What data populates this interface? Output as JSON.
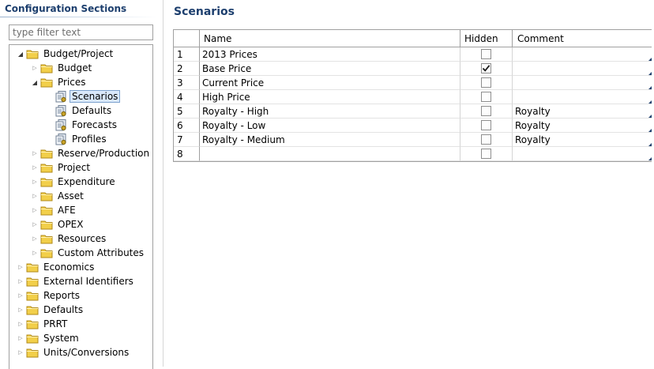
{
  "sidebar": {
    "title": "Configuration Sections",
    "filter_placeholder": "type filter text",
    "items": [
      {
        "label": "Budget/Project",
        "depth": 1,
        "state": "open",
        "icon": "folder-icon"
      },
      {
        "label": "Budget",
        "depth": 2,
        "state": "closed",
        "icon": "folder-icon"
      },
      {
        "label": "Prices",
        "depth": 2,
        "state": "open",
        "icon": "folder-icon"
      },
      {
        "label": "Scenarios",
        "depth": 3,
        "state": "leaf",
        "icon": "config-page-icon",
        "selected": true
      },
      {
        "label": "Defaults",
        "depth": 3,
        "state": "leaf",
        "icon": "config-page-icon"
      },
      {
        "label": "Forecasts",
        "depth": 3,
        "state": "leaf",
        "icon": "config-page-icon"
      },
      {
        "label": "Profiles",
        "depth": 3,
        "state": "leaf",
        "icon": "config-page-icon"
      },
      {
        "label": "Reserve/Production",
        "depth": 2,
        "state": "closed",
        "icon": "folder-icon"
      },
      {
        "label": "Project",
        "depth": 2,
        "state": "closed",
        "icon": "folder-icon"
      },
      {
        "label": "Expenditure",
        "depth": 2,
        "state": "closed",
        "icon": "folder-icon"
      },
      {
        "label": "Asset",
        "depth": 2,
        "state": "closed",
        "icon": "folder-icon"
      },
      {
        "label": "AFE",
        "depth": 2,
        "state": "closed",
        "icon": "folder-icon"
      },
      {
        "label": "OPEX",
        "depth": 2,
        "state": "closed",
        "icon": "folder-icon"
      },
      {
        "label": "Resources",
        "depth": 2,
        "state": "closed",
        "icon": "folder-icon"
      },
      {
        "label": "Custom Attributes",
        "depth": 2,
        "state": "closed",
        "icon": "folder-icon"
      },
      {
        "label": "Economics",
        "depth": 1,
        "state": "closed",
        "icon": "folder-icon"
      },
      {
        "label": "External Identifiers",
        "depth": 1,
        "state": "closed",
        "icon": "folder-icon"
      },
      {
        "label": "Reports",
        "depth": 1,
        "state": "closed",
        "icon": "folder-icon"
      },
      {
        "label": "Defaults",
        "depth": 1,
        "state": "closed",
        "icon": "folder-icon"
      },
      {
        "label": "PRRT",
        "depth": 1,
        "state": "closed",
        "icon": "folder-icon"
      },
      {
        "label": "System",
        "depth": 1,
        "state": "closed",
        "icon": "folder-icon"
      },
      {
        "label": "Units/Conversions",
        "depth": 1,
        "state": "closed",
        "icon": "folder-icon"
      }
    ]
  },
  "main": {
    "title": "Scenarios",
    "columns": [
      "",
      "Name",
      "Hidden",
      "Comment"
    ],
    "rows": [
      {
        "num": "1",
        "name": "2013 Prices",
        "hidden": false,
        "comment": ""
      },
      {
        "num": "2",
        "name": "Base Price",
        "hidden": true,
        "comment": ""
      },
      {
        "num": "3",
        "name": "Current Price",
        "hidden": false,
        "comment": ""
      },
      {
        "num": "4",
        "name": "High Price",
        "hidden": false,
        "comment": ""
      },
      {
        "num": "5",
        "name": "Royalty - High",
        "hidden": false,
        "comment": "Royalty"
      },
      {
        "num": "6",
        "name": "Royalty - Low",
        "hidden": false,
        "comment": "Royalty"
      },
      {
        "num": "7",
        "name": "Royalty - Medium",
        "hidden": false,
        "comment": "Royalty"
      },
      {
        "num": "8",
        "name": "",
        "hidden": false,
        "comment": ""
      }
    ]
  },
  "colors": {
    "title": "#1d3f6e",
    "folder_fill": "#f2cf4a",
    "folder_stroke": "#b08a1a",
    "selection_bg": "#d9e8fb",
    "selection_border": "#7da2ce"
  }
}
